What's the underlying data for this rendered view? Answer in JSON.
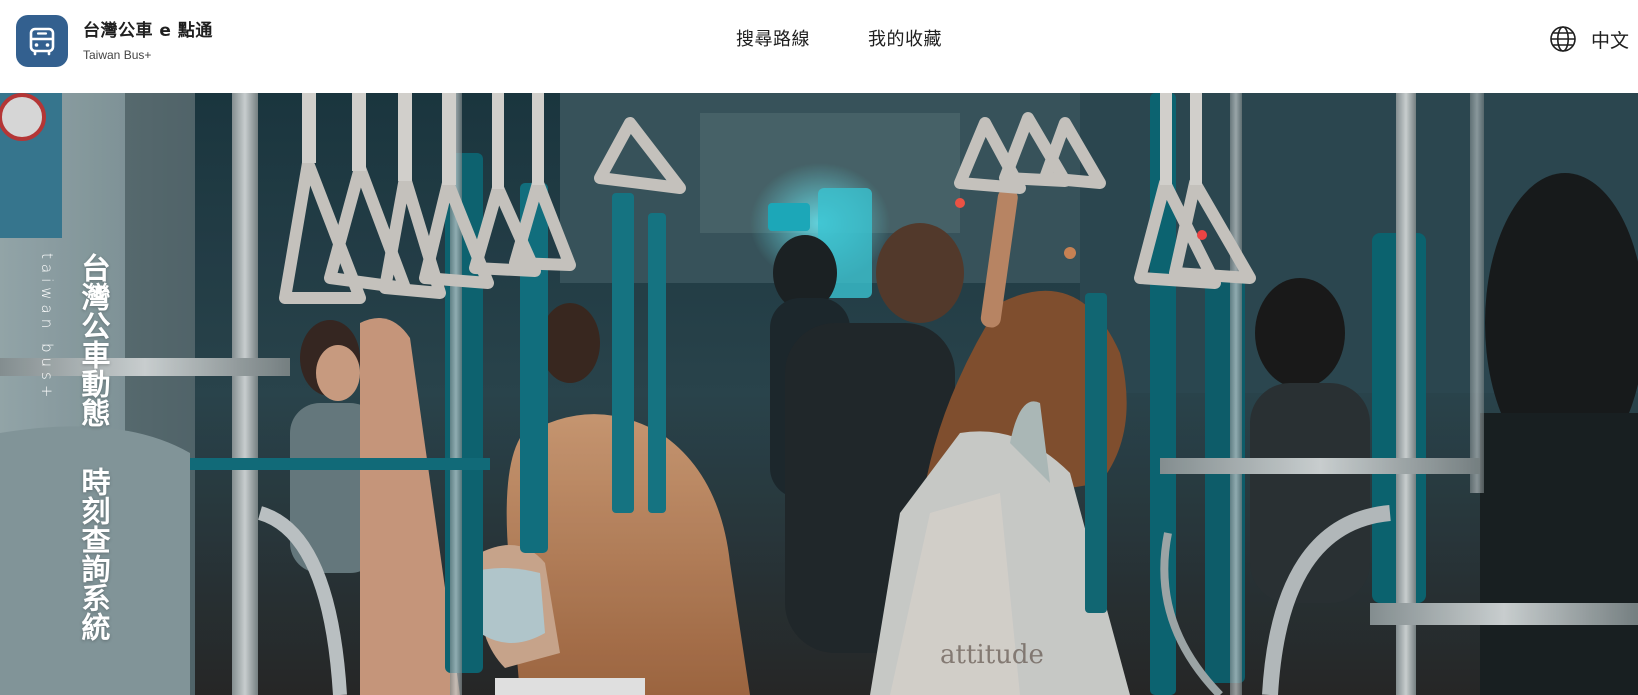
{
  "header": {
    "brand": {
      "title": "台灣公車 e 點通",
      "subtitle": "Taiwan Bus+",
      "logo_icon": "bus-icon",
      "logo_color": "#33608f"
    },
    "nav": [
      {
        "label": "搜尋路線"
      },
      {
        "label": "我的收藏"
      }
    ],
    "language": {
      "icon": "globe-icon",
      "label": "中文"
    }
  },
  "hero": {
    "title_line_1": "台灣公車動態",
    "title_line_2": "時刻查詢系統",
    "tagline": "taiwan bus+",
    "image": "photo of passengers standing inside a bus holding hand straps"
  }
}
